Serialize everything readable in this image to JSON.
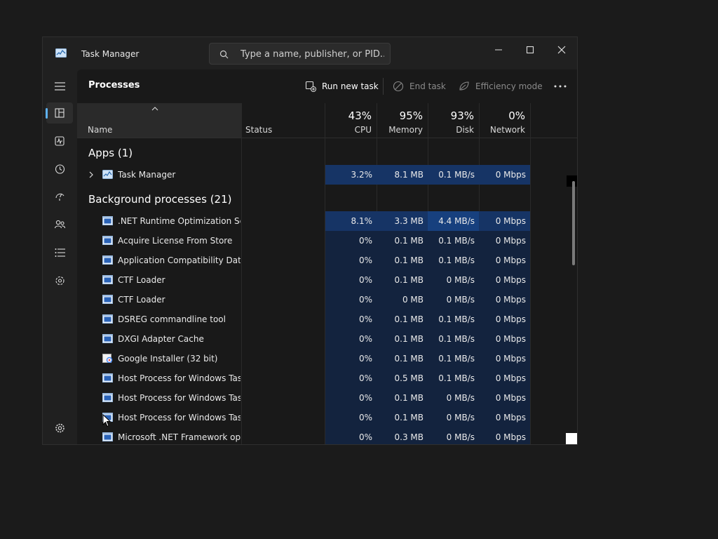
{
  "window": {
    "title": "Task Manager"
  },
  "search": {
    "placeholder": "Type a name, publisher, or PID..."
  },
  "page": {
    "title": "Processes"
  },
  "toolbar": {
    "run_new_task": "Run new task",
    "end_task": "End task",
    "efficiency_mode": "Efficiency mode"
  },
  "columns": {
    "name": "Name",
    "status": "Status",
    "cpu": {
      "pct": "43%",
      "label": "CPU"
    },
    "memory": {
      "pct": "95%",
      "label": "Memory"
    },
    "disk": {
      "pct": "93%",
      "label": "Disk"
    },
    "network": {
      "pct": "0%",
      "label": "Network"
    }
  },
  "groups": {
    "apps": "Apps (1)",
    "background": "Background processes (21)"
  },
  "apps": [
    {
      "name": "Task Manager",
      "cpu": "3.2%",
      "memory": "8.1 MB",
      "disk": "0.1 MB/s",
      "network": "0 Mbps"
    }
  ],
  "processes": [
    {
      "name": ".NET Runtime Optimization Se...",
      "cpu": "8.1%",
      "memory": "3.3 MB",
      "disk": "4.4 MB/s",
      "network": "0 Mbps"
    },
    {
      "name": "Acquire License From Store",
      "cpu": "0%",
      "memory": "0.1 MB",
      "disk": "0.1 MB/s",
      "network": "0 Mbps"
    },
    {
      "name": "Application Compatibility Dat...",
      "cpu": "0%",
      "memory": "0.1 MB",
      "disk": "0.1 MB/s",
      "network": "0 Mbps"
    },
    {
      "name": "CTF Loader",
      "cpu": "0%",
      "memory": "0.1 MB",
      "disk": "0 MB/s",
      "network": "0 Mbps"
    },
    {
      "name": "CTF Loader",
      "cpu": "0%",
      "memory": "0 MB",
      "disk": "0 MB/s",
      "network": "0 Mbps"
    },
    {
      "name": "DSREG commandline tool",
      "cpu": "0%",
      "memory": "0.1 MB",
      "disk": "0.1 MB/s",
      "network": "0 Mbps"
    },
    {
      "name": "DXGI Adapter Cache",
      "cpu": "0%",
      "memory": "0.1 MB",
      "disk": "0.1 MB/s",
      "network": "0 Mbps"
    },
    {
      "name": "Google Installer (32 bit)",
      "cpu": "0%",
      "memory": "0.1 MB",
      "disk": "0.1 MB/s",
      "network": "0 Mbps"
    },
    {
      "name": "Host Process for Windows Tasks",
      "cpu": "0%",
      "memory": "0.5 MB",
      "disk": "0.1 MB/s",
      "network": "0 Mbps"
    },
    {
      "name": "Host Process for Windows Tasks",
      "cpu": "0%",
      "memory": "0.1 MB",
      "disk": "0 MB/s",
      "network": "0 Mbps"
    },
    {
      "name": "Host Process for Windows Tasks",
      "cpu": "0%",
      "memory": "0.1 MB",
      "disk": "0 MB/s",
      "network": "0 Mbps"
    },
    {
      "name": "Microsoft .NET Framework op...",
      "cpu": "0%",
      "memory": "0.3 MB",
      "disk": "0 MB/s",
      "network": "0 Mbps"
    }
  ],
  "icons": {
    "sidebar": [
      "hamburger-icon",
      "processes-icon",
      "performance-icon",
      "app-history-icon",
      "startup-apps-icon",
      "users-icon",
      "details-icon",
      "services-icon",
      "settings-icon"
    ]
  },
  "colors": {
    "accent": "#5fb2f2",
    "heat_low": "#13233e",
    "heat_mid": "#163465",
    "heat_high": "#17407e"
  }
}
